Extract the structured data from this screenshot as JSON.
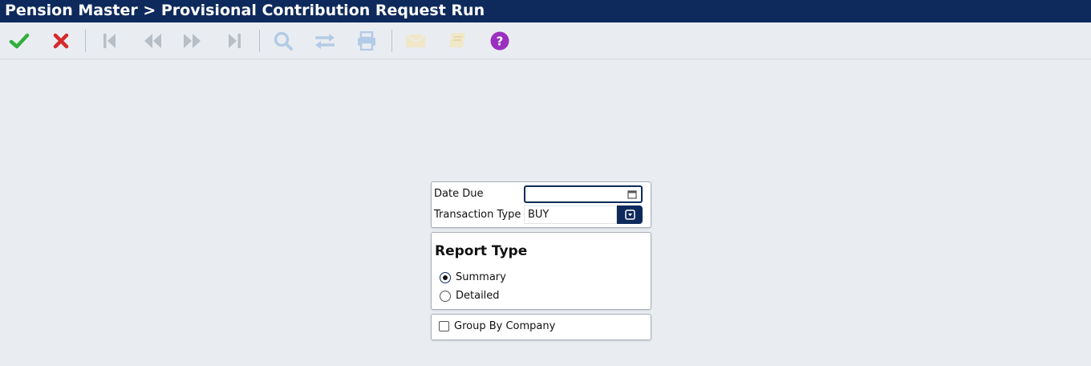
{
  "window": {
    "title": "Pension Master > Provisional Contribution Request Run"
  },
  "toolbar": {
    "buttons": [
      {
        "icon": "checkmark-icon",
        "label": "OK",
        "enabled": true,
        "color": "#2fae3c"
      },
      {
        "icon": "close-icon",
        "label": "Cancel",
        "enabled": true,
        "color": "#d42a2a"
      },
      {
        "icon": "first-record-icon",
        "label": "First",
        "enabled": false
      },
      {
        "icon": "previous-record-icon",
        "label": "Previous",
        "enabled": false
      },
      {
        "icon": "next-record-icon",
        "label": "Next",
        "enabled": false
      },
      {
        "icon": "last-record-icon",
        "label": "Last",
        "enabled": false
      },
      {
        "icon": "search-icon",
        "label": "Search",
        "enabled": false
      },
      {
        "icon": "swap-icon",
        "label": "Transfer",
        "enabled": false
      },
      {
        "icon": "printer-icon",
        "label": "Print",
        "enabled": false
      },
      {
        "icon": "envelope-icon",
        "label": "Email",
        "enabled": false
      },
      {
        "icon": "book-icon",
        "label": "Notes",
        "enabled": false
      },
      {
        "icon": "help-icon",
        "label": "Help",
        "enabled": true,
        "color": "#9b2fc0"
      }
    ]
  },
  "form": {
    "date_due": {
      "label": "Date Due",
      "value": ""
    },
    "transaction_type": {
      "label": "Transaction Type",
      "value": "BUY"
    },
    "report_type": {
      "title": "Report Type",
      "options": [
        {
          "label": "Summary",
          "selected": true
        },
        {
          "label": "Detailed",
          "selected": false
        }
      ]
    },
    "group_by_company": {
      "label": "Group By Company",
      "checked": false
    }
  },
  "colors": {
    "titlebar": "#0e2a5c",
    "background": "#e9edf1",
    "accent": "#0e2a5c"
  }
}
